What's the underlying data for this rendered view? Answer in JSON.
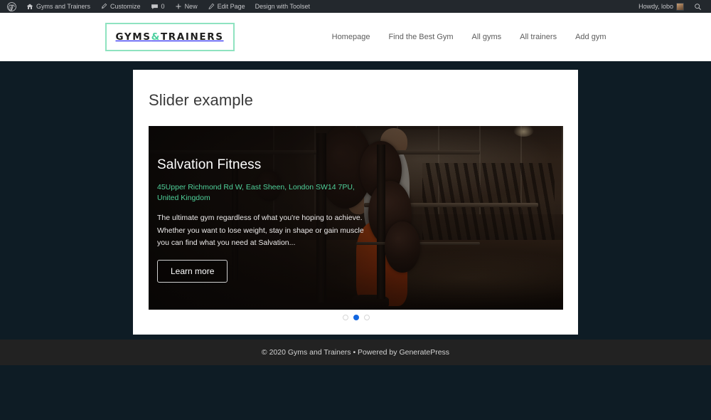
{
  "adminbar": {
    "wp_logo": "wordpress-logo",
    "site_name": "Gyms and Trainers",
    "customize": "Customize",
    "comments_count": "0",
    "new": "New",
    "edit_page": "Edit Page",
    "toolset": "Design with Toolset",
    "howdy": "Howdy, lobo",
    "search": "search-icon"
  },
  "header": {
    "logo": {
      "part1": "GYMS",
      "amp": "&",
      "part2": "TRAINERS",
      "border_color": "#8fe3c0",
      "amp_color": "#4dd0a0"
    },
    "nav": [
      {
        "label": "Homepage"
      },
      {
        "label": "Find the Best Gym"
      },
      {
        "label": "All gyms"
      },
      {
        "label": "All trainers"
      },
      {
        "label": "Add gym"
      }
    ]
  },
  "main": {
    "page_title": "Slider example",
    "slider": {
      "slide_title": "Salvation Fitness",
      "address": "45Upper Richmond Rd W, East Sheen, London SW14 7PU, United Kingdom",
      "description": "The ultimate gym regardless of what you're hoping to achieve. Whether you want to lose weight, stay in shape or gain muscle you can find what you need at Salvation...",
      "button_label": "Learn more",
      "dots": [
        {
          "active": false
        },
        {
          "active": true
        },
        {
          "active": false
        }
      ],
      "active_dot_color": "#1266e0"
    }
  },
  "footer": {
    "copyright": "© 2020 Gyms and Trainers • Powered by ",
    "platform": "GeneratePress"
  },
  "colors": {
    "page_background": "#0e1c25",
    "footer_background": "#222222",
    "address_green": "#4fd19a"
  }
}
